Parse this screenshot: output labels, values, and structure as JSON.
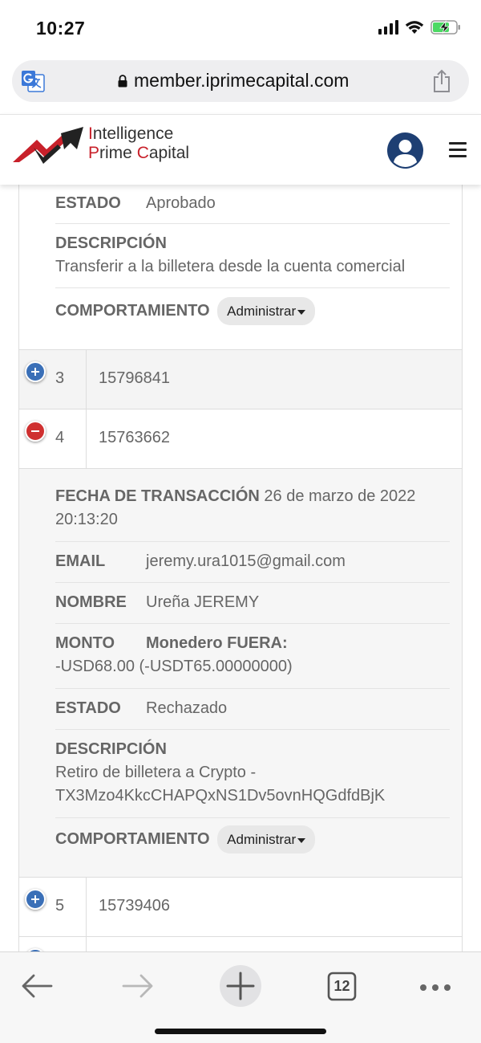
{
  "status_bar": {
    "time": "10:27"
  },
  "browser": {
    "url": "member.iprimecapital.com",
    "icons": [
      "translate-icon",
      "lock-icon",
      "share-icon"
    ]
  },
  "site": {
    "logo_line1_accent": "I",
    "logo_line1_rest": "ntelligence",
    "logo_line2_a": "P",
    "logo_line2_b": "rime ",
    "logo_line2_c": "C",
    "logo_line2_d": "apital",
    "brand_red": "#c8202a",
    "avatar_color": "#1e3f73"
  },
  "transactions": {
    "prev_detail": {
      "estado_label": "ESTADO",
      "estado_value": "Aprobado",
      "descripcion_label": "DESCRIPCIÓN",
      "descripcion_value": "Transferir a la billetera desde la cuenta comercial",
      "comportamiento_label": "COMPORTAMIENTO",
      "action_label": "Administrar"
    },
    "rows": [
      {
        "index": "3",
        "id": "15796841",
        "expanded": false
      },
      {
        "index": "4",
        "id": "15763662",
        "expanded": true
      },
      {
        "index": "5",
        "id": "15739406",
        "expanded": false
      }
    ],
    "expanded_detail": {
      "fecha_label": "FECHA DE TRANSACCIÓN",
      "fecha_value_line1": "26 de marzo de 2022",
      "fecha_value_line2": "20:13:20",
      "email_label": "EMAIL",
      "email_value": "jeremy.ura1015@gmail.com",
      "nombre_label": "NOMBRE",
      "nombre_value": "Ureña JEREMY",
      "monto_label": "MONTO",
      "monedero_label": "Monedero FUERA:",
      "monto_value": "-USD68.00 (-USDT65.00000000)",
      "estado_label": "ESTADO",
      "estado_value": "Rechazado",
      "descripcion_label": "DESCRIPCIÓN",
      "descripcion_line1": "Retiro de billetera a Crypto -",
      "descripcion_line2": "TX3Mzo4KkcCHAPQxNS1Dv5ovnHQGdfdBjK",
      "comportamiento_label": "COMPORTAMIENTO",
      "action_label": "Administrar"
    }
  },
  "toolbar": {
    "tab_count": "12"
  }
}
